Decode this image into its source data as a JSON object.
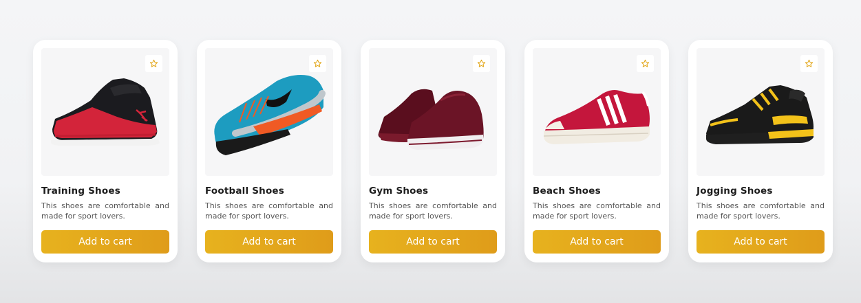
{
  "accent_color": "#e3a81c",
  "products": [
    {
      "name": "Training Shoes",
      "description": "This shoes are comfortable and made for sport lovers.",
      "button_label": "Add to cart",
      "icon": "star-icon"
    },
    {
      "name": "Football Shoes",
      "description": "This shoes are comfortable and made for sport lovers.",
      "button_label": "Add to cart",
      "icon": "star-icon"
    },
    {
      "name": "Gym Shoes",
      "description": "This shoes are comfortable and made for sport lovers.",
      "button_label": "Add to cart",
      "icon": "star-icon"
    },
    {
      "name": "Beach Shoes",
      "description": "This shoes are comfortable and made for sport lovers.",
      "button_label": "Add to cart",
      "icon": "star-icon"
    },
    {
      "name": "Jogging Shoes",
      "description": "This shoes are comfortable and made for sport lovers.",
      "button_label": "Add to cart",
      "icon": "star-icon"
    }
  ]
}
